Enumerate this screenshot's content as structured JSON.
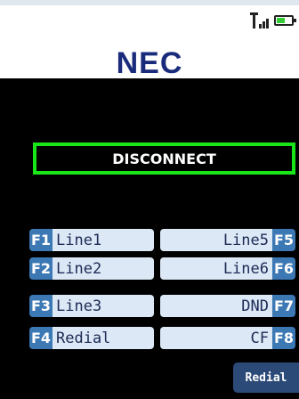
{
  "header": {
    "logo": "NEC",
    "battery_level": 0.55,
    "signal_bars": 3
  },
  "call": {
    "status_label": "DISCONNECT"
  },
  "function_keys": {
    "left": [
      {
        "key": "F1",
        "label": "Line1"
      },
      {
        "key": "F2",
        "label": "Line2"
      },
      {
        "key": "F3",
        "label": "Line3"
      },
      {
        "key": "F4",
        "label": "Redial"
      }
    ],
    "right": [
      {
        "key": "F5",
        "label": "Line5"
      },
      {
        "key": "F6",
        "label": "Line6"
      },
      {
        "key": "F7",
        "label": "DND"
      },
      {
        "key": "F8",
        "label": "CF"
      }
    ]
  },
  "softkeys": {
    "right_label": "Redial"
  },
  "colors": {
    "accent_green": "#19e619",
    "key_blue": "#3c78b4",
    "label_bg": "#dce8f5",
    "logo_blue": "#1a2b7c"
  }
}
